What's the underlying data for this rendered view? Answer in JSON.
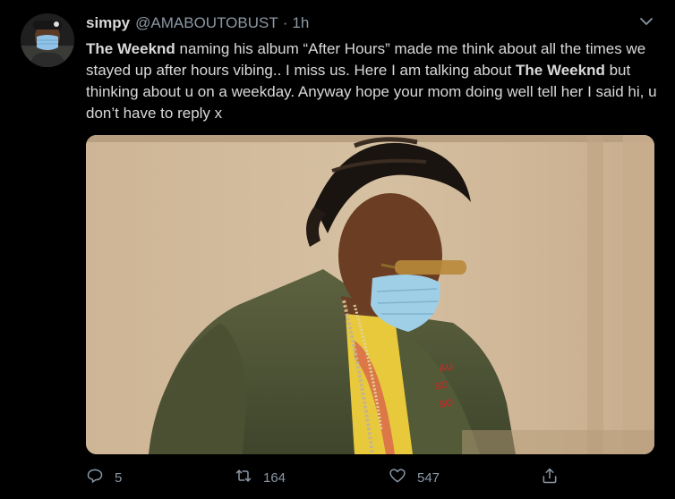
{
  "tweet": {
    "display_name": "simpy",
    "handle": "@AMABOUTOBUST",
    "separator": "·",
    "time": "1h",
    "text_segments": [
      {
        "text": "The Weeknd",
        "bold": true
      },
      {
        "text": " naming his album “After Hours” made me think about all the times we stayed up after hours vibing.. I miss us. Here I am talking about ",
        "bold": false
      },
      {
        "text": "The Weeknd",
        "bold": true
      },
      {
        "text": " but thinking about u on a weekday. Anyway hope your mom doing well tell her I said hi, u don’t have to reply x",
        "bold": false
      }
    ],
    "media_icon": "photo-man-face-mask-olive-bomber-jacket",
    "avatar_icon": "avatar-man-face-mask"
  },
  "actions": {
    "reply_count": "5",
    "retweet_count": "164",
    "like_count": "547",
    "reply_icon": "speech-bubble-icon",
    "retweet_icon": "retweet-arrows-icon",
    "like_icon": "heart-outline-icon",
    "share_icon": "share-upload-icon"
  },
  "colors": {
    "background": "#000000",
    "text": "#d9d9d9",
    "secondary": "#8b98a5"
  }
}
